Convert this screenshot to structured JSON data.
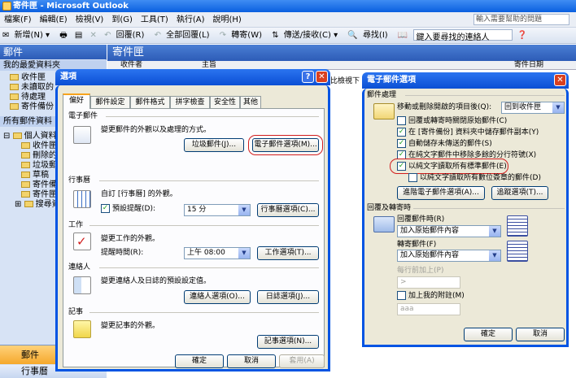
{
  "app": {
    "title": "寄件匣 - Microsoft Outlook",
    "ask_placeholder": "輸入需要幫助的問題"
  },
  "menu": [
    "檔案(F)",
    "編輯(E)",
    "檢視(V)",
    "到(G)",
    "工具(T)",
    "執行(A)",
    "說明(H)"
  ],
  "toolbar": {
    "new": "新增(N) ▾",
    "reply": "回覆(R)",
    "reply_all": "全部回覆(L)",
    "forward": "轉寄(W)",
    "send_receive": "傳送/接收(C) ▾",
    "find": "尋找(I)",
    "contact_search": "鍵入要尋找的連絡人"
  },
  "nav": {
    "header": "郵件",
    "favorites_header": "我的最愛資料夾",
    "favorites": [
      "收件匣",
      "未讀取的",
      "待處理",
      "寄件備份"
    ],
    "all_folders_header": "所有郵件資料",
    "tree_root": "個人資料",
    "tree": [
      "收件匣",
      "刪除的",
      "垃圾郵",
      "草稿",
      "寄件備",
      "寄件匣",
      "搜尋資"
    ],
    "btn_mail": "郵件",
    "btn_calendar": "行事曆"
  },
  "main": {
    "header": "寄件匣",
    "col_from": "收件者",
    "col_subject": "主旨",
    "col_date": "寄件日期",
    "view_hint": "比檢視下"
  },
  "options": {
    "title": "選項",
    "tabs": [
      "偏好",
      "郵件設定",
      "郵件格式",
      "拼字檢查",
      "安全性",
      "其他"
    ],
    "sections": {
      "email": {
        "header": "電子郵件",
        "desc": "變更郵件的外觀以及處理的方式。",
        "btn_junk": "垃圾郵件(J)...",
        "btn_email_options": "電子郵件選項(M)..."
      },
      "calendar": {
        "header": "行事曆",
        "desc": "自訂 [行事曆] 的外觀。",
        "reminder_label": "預設提醒(D):",
        "reminder_value": "15 分",
        "btn": "行事曆選項(C)..."
      },
      "tasks": {
        "header": "工作",
        "desc": "變更工作的外觀。",
        "time_label": "提醒時間(R):",
        "time_value": "上午 08:00",
        "btn": "工作選項(T)..."
      },
      "contacts": {
        "header": "連絡人",
        "desc": "變更連絡人及日誌的預設設定值。",
        "btn_contacts": "連絡人選項(O)...",
        "btn_journal": "日誌選項(J)..."
      },
      "notes": {
        "header": "記事",
        "desc": "變更記事的外觀。",
        "btn": "記事選項(N)..."
      }
    },
    "ok": "確定",
    "cancel": "取消",
    "apply": "套用(A)"
  },
  "email_options": {
    "title": "電子郵件選項",
    "group_handling": "郵件處理",
    "after_move_label": "移動或刪除開啟的項目後(Q):",
    "after_move_value": "回到收件匣",
    "checks": [
      {
        "label": "回覆或轉寄時關閉原始郵件(C)",
        "checked": false
      },
      {
        "label": "在 [寄件備份] 資料夾中儲存郵件副本(Y)",
        "checked": true
      },
      {
        "label": "自動儲存未傳送的郵件(S)",
        "checked": true
      },
      {
        "label": "在純文字郵件中移除多餘的分行符號(X)",
        "checked": true
      },
      {
        "label": "以純文字讀取所有標準郵件(E)",
        "checked": true
      },
      {
        "label": "以純文字讀取所有數位簽章的郵件(D)",
        "checked": false
      }
    ],
    "btn_advanced": "進階電子郵件選項(A)...",
    "btn_tracking": "追蹤選項(T)...",
    "group_reply": "回覆及轉寄時",
    "reply_label": "回覆郵件時(R)",
    "reply_value": "加入原始郵件內容",
    "forward_label": "轉寄郵件(F)",
    "forward_value": "加入原始郵件內容",
    "prefix_label": "每行前加上(P)",
    "prefix_value": ">",
    "comment_label": "加上我的附註(M)",
    "comment_value": "aaa",
    "ok": "確定",
    "cancel": "取消"
  }
}
